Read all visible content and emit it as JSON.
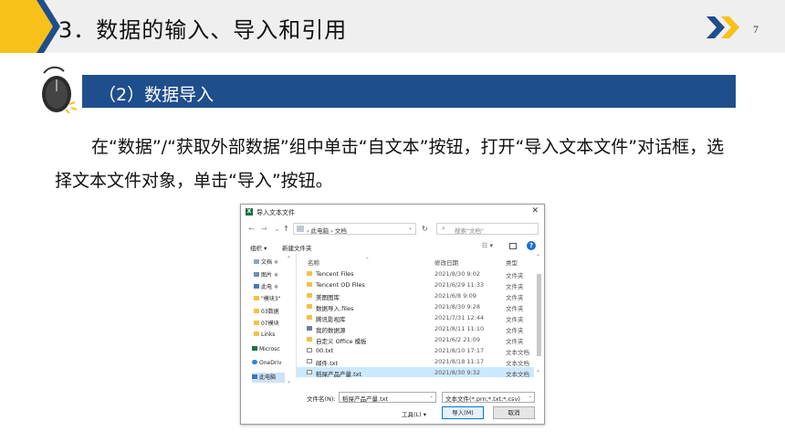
{
  "header": {
    "title": "3．数据的输入、导入和引用",
    "page_number": "7"
  },
  "section": {
    "title": "（2）数据导入"
  },
  "paragraph": "在“数据”/“获取外部数据”组中单击“自文本”按钮，打开“导入文本文件”对话框，选择文本文件对象，单击“导入”按钮。",
  "dialog": {
    "title": "导入文本文件",
    "close": "✕",
    "nav": {
      "back": "←",
      "forward": "→",
      "up": "↑",
      "refresh": "↻"
    },
    "address": {
      "path": "› 此电脑 › 文档",
      "dropdown": "⌄"
    },
    "search": {
      "icon": "⌕",
      "placeholder": "搜索\"文档\""
    },
    "toolbar": {
      "organize": "组织 ▾",
      "new_folder": "新建文件夹",
      "view": "☷ ▾",
      "help": "?"
    },
    "nav_pane": [
      {
        "label": "文档",
        "icon": "document-icon",
        "pin": "✱"
      },
      {
        "label": "图片",
        "icon": "pictures-icon",
        "pin": "✱"
      },
      {
        "label": "此电",
        "icon": "computer-icon",
        "pin": "✱"
      },
      {
        "label": "\"模块3\"",
        "icon": "folder-icon"
      },
      {
        "label": "03数据",
        "icon": "folder-icon"
      },
      {
        "label": "07模块",
        "icon": "folder-icon"
      },
      {
        "label": "Links",
        "icon": "folder-icon"
      },
      {
        "label": "Microsc",
        "icon": "excel-icon"
      },
      {
        "label": "OneDriv",
        "icon": "onedrive-icon"
      },
      {
        "label": "此电脑",
        "icon": "computer-icon"
      }
    ],
    "columns": {
      "name": "名称",
      "modified": "修改日期",
      "type": "类型"
    },
    "files": [
      {
        "name": "Tencent Files",
        "modified": "2021/8/30 9:02",
        "type": "文件夹",
        "kind": "folder"
      },
      {
        "name": "Tencent OD Files",
        "modified": "2021/6/29 11:33",
        "type": "文件夹",
        "kind": "folder"
      },
      {
        "name": "美图图库",
        "modified": "2021/6/8 9:09",
        "type": "文件夹",
        "kind": "folder"
      },
      {
        "name": "数据导入.files",
        "modified": "2021/8/30 9:28",
        "type": "文件夹",
        "kind": "folder"
      },
      {
        "name": "腾讯影视库",
        "modified": "2021/7/31 12:44",
        "type": "文件夹",
        "kind": "folder"
      },
      {
        "name": "我的数据源",
        "modified": "2021/8/11 11:10",
        "type": "文件夹",
        "kind": "app"
      },
      {
        "name": "自定义 Office 模板",
        "modified": "2021/6/2 21:09",
        "type": "文件夹",
        "kind": "folder"
      },
      {
        "name": "00.txt",
        "modified": "2021/8/10 17:17",
        "type": "文本文档",
        "kind": "txt"
      },
      {
        "name": "邮件.txt",
        "modified": "2021/8/18 11:17",
        "type": "文本文档",
        "kind": "txt"
      },
      {
        "name": "稻屎产品产量.txt",
        "modified": "2021/8/30 9:32",
        "type": "文本文档",
        "kind": "txt",
        "selected": true
      }
    ],
    "filename_label": "文件名(N):",
    "filename_value": "稻屎产品产量.txt",
    "filetype_value": "文本文件(*.prn;*.txt;*.csv)",
    "tools_label": "工具(L)  ▾",
    "import_button": "导入(M)",
    "cancel_button": "取消"
  }
}
